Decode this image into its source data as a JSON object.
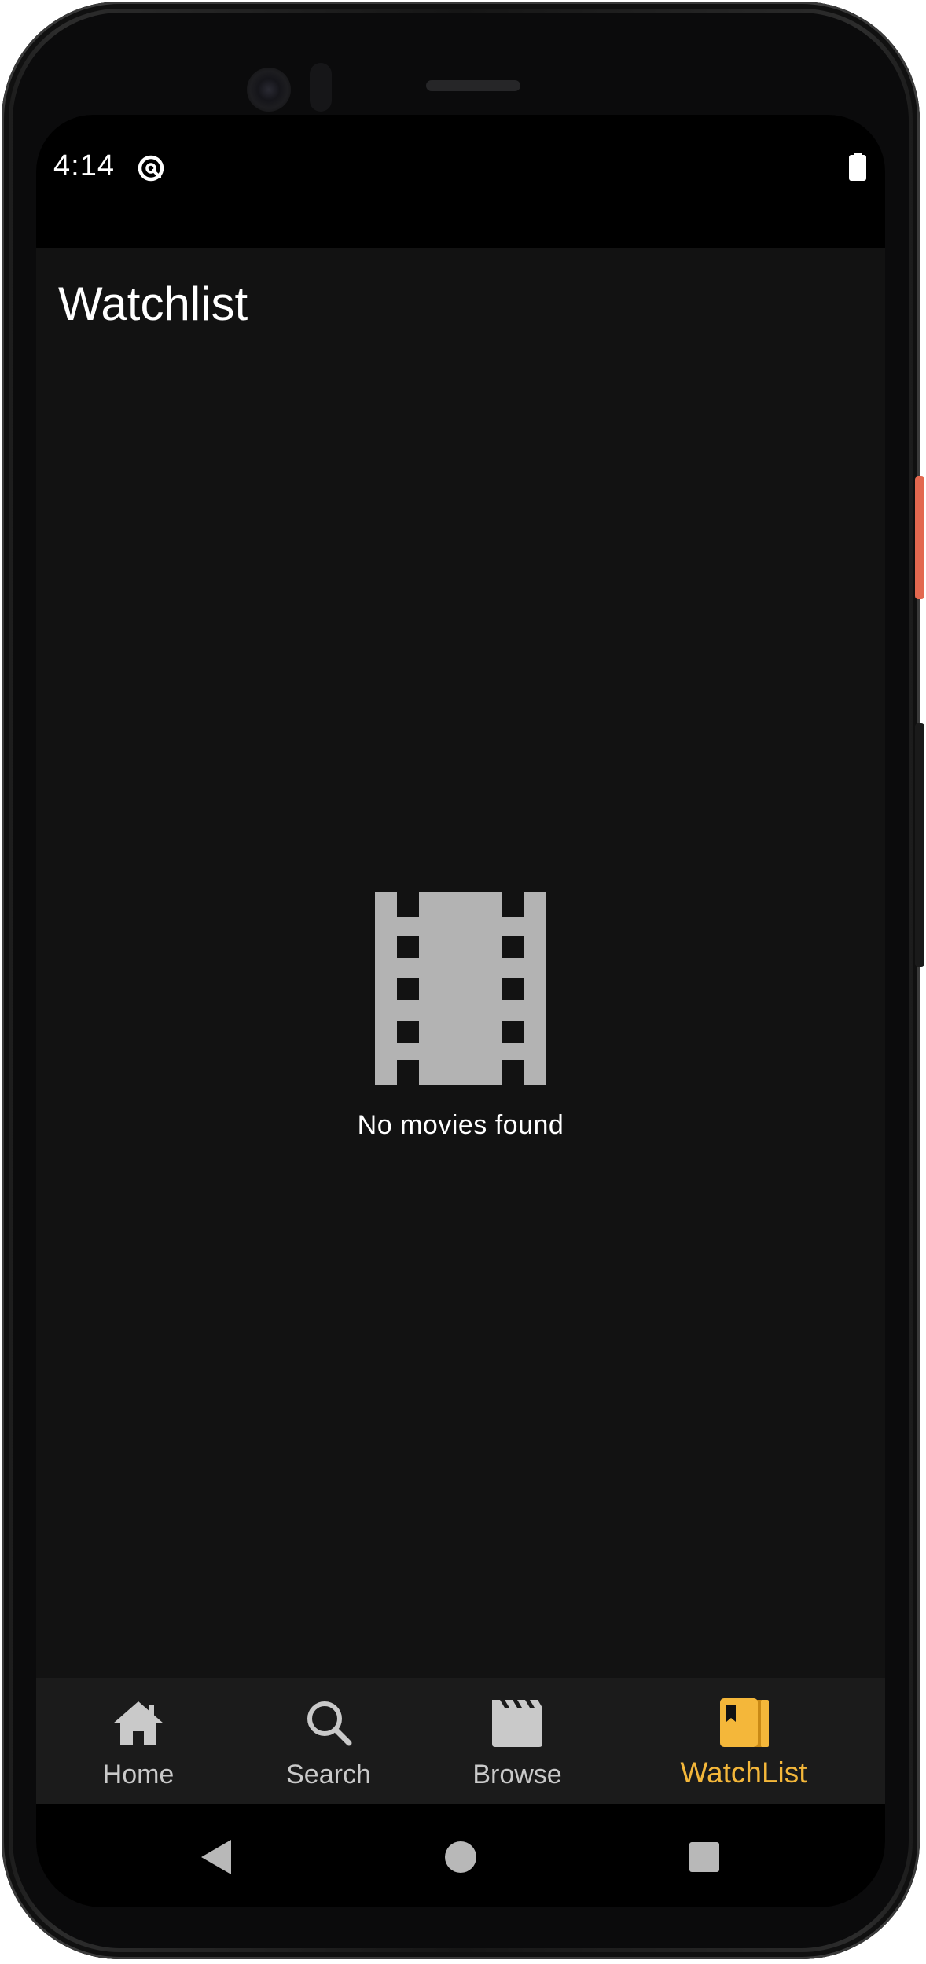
{
  "status_bar": {
    "time": "4:14",
    "icons": [
      "data-saver-icon",
      "battery-icon"
    ]
  },
  "page": {
    "title": "Watchlist"
  },
  "empty_state": {
    "icon": "movie-film-icon",
    "message": "No movies found"
  },
  "bottom_nav": {
    "items": [
      {
        "label": "Home",
        "icon": "home-icon",
        "active": false
      },
      {
        "label": "Search",
        "icon": "search-icon",
        "active": false
      },
      {
        "label": "Browse",
        "icon": "clapperboard-icon",
        "active": false
      },
      {
        "label": "WatchList",
        "icon": "bookmark-book-icon",
        "active": true
      }
    ]
  },
  "system_nav": {
    "buttons": [
      "back-icon",
      "home-circle-icon",
      "recents-square-icon"
    ]
  },
  "colors": {
    "background": "#121212",
    "nav_background": "#1b1b1b",
    "accent": "#f4b73a",
    "inactive": "#c9c9c9",
    "empty_icon": "#b3b3b3"
  }
}
